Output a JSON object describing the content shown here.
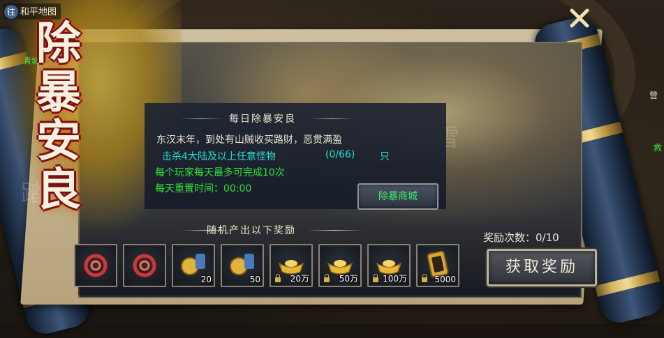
{
  "header": {
    "map_badge": "往",
    "map_name": "和平地图",
    "city_label": "青城"
  },
  "event": {
    "big_title": [
      "除",
      "暴",
      "安",
      "良"
    ],
    "section_title": "每日除暴安良",
    "description": "东汉末年，到处有山贼收买路财，恶贯满盈",
    "task_text": "击杀4大陆及以上任意怪物",
    "task_progress": "(0/66)",
    "task_unit": "只",
    "limit_text": "每个玩家每天最多可完成10次",
    "reset_text": "每天重置时间：00:00",
    "shop_button": "除暴商城"
  },
  "rewards": {
    "section_title": "随机产出以下奖励",
    "count_label": "奖励次数：0/10",
    "claim_button": "获取奖励",
    "items": [
      {
        "icon": "red-swirl-orb-icon",
        "qty": ""
      },
      {
        "icon": "red-swirl-orb-icon",
        "qty": ""
      },
      {
        "icon": "gold-coin-scroll-icon",
        "qty": "20"
      },
      {
        "icon": "gold-coin-scroll-icon",
        "qty": "50"
      },
      {
        "icon": "gold-ingot-icon",
        "qty": "20万"
      },
      {
        "icon": "gold-ingot-icon",
        "qty": "50万"
      },
      {
        "icon": "gold-ingot-icon",
        "qty": "100万"
      },
      {
        "icon": "golden-token-icon",
        "qty": "5000"
      }
    ]
  },
  "side": {
    "right_top": "营",
    "right_mid": "救"
  },
  "watermark": "踏雪",
  "colors": {
    "cyan_text": "#22e0d4",
    "green_text": "#33e03a",
    "title_outline": "#7a1010"
  }
}
